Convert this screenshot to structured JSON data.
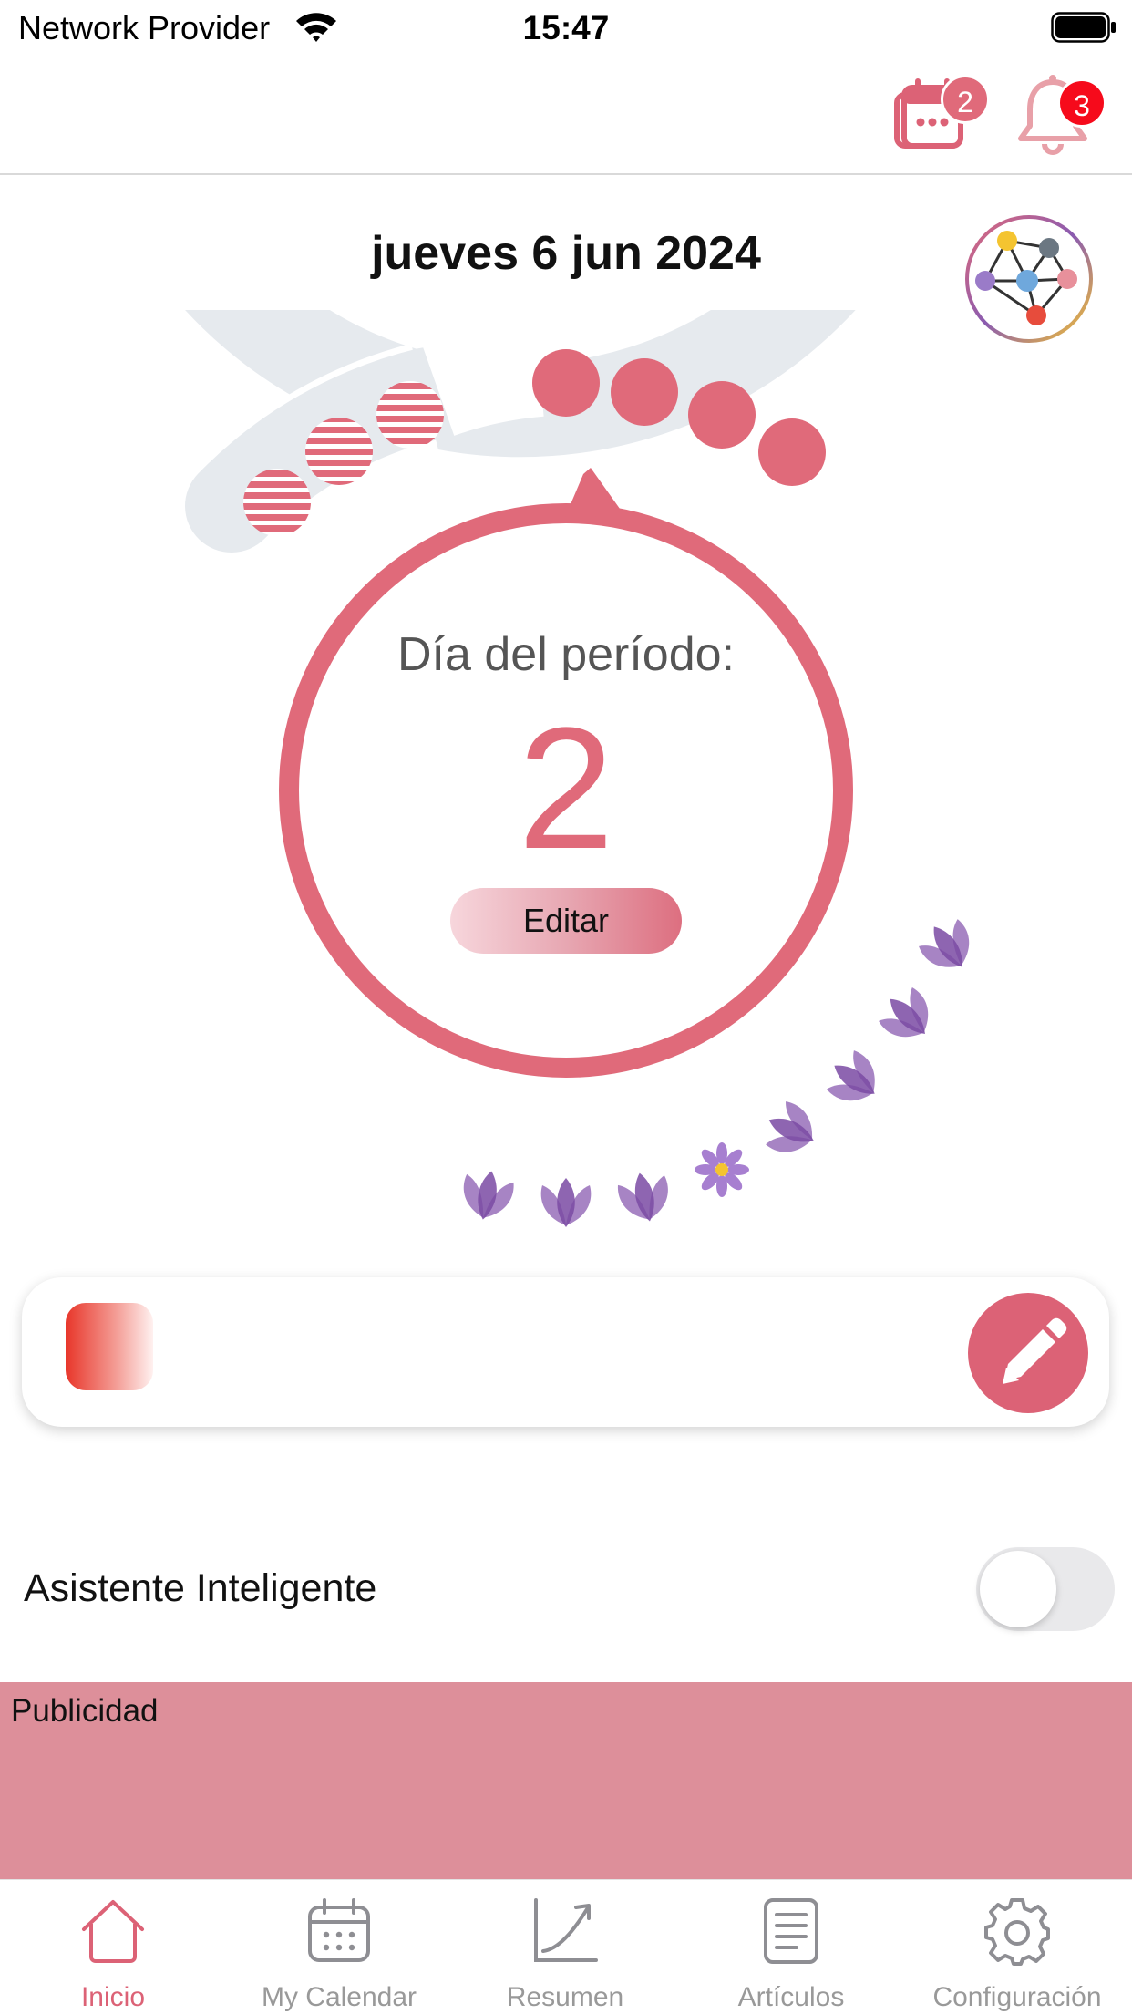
{
  "status_bar": {
    "carrier": "Network Provider",
    "time": "15:47"
  },
  "header": {
    "calendar_badge": "2",
    "notifications_badge": "3"
  },
  "main": {
    "date": "jueves 6 jun 2024",
    "center_label": "Día del período:",
    "period_day": "2",
    "edit_label": "Editar"
  },
  "assistant": {
    "label": "Asistente Inteligente",
    "enabled": false
  },
  "ad": {
    "label": "Publicidad"
  },
  "tabs": [
    {
      "label": "Inicio",
      "icon": "home-icon",
      "active": true
    },
    {
      "label": "My Calendar",
      "icon": "calendar-icon",
      "active": false
    },
    {
      "label": "Resumen",
      "icon": "chart-trend-icon",
      "active": false
    },
    {
      "label": "Artículos",
      "icon": "article-icon",
      "active": false
    },
    {
      "label": "Configuración",
      "icon": "gear-icon",
      "active": false
    }
  ],
  "colors": {
    "accent": "#dc6276",
    "ring": "#e06a7a",
    "track": "#e6eaee",
    "fertile": "#8a5bb0",
    "ad_background": "#dd8f9a"
  }
}
